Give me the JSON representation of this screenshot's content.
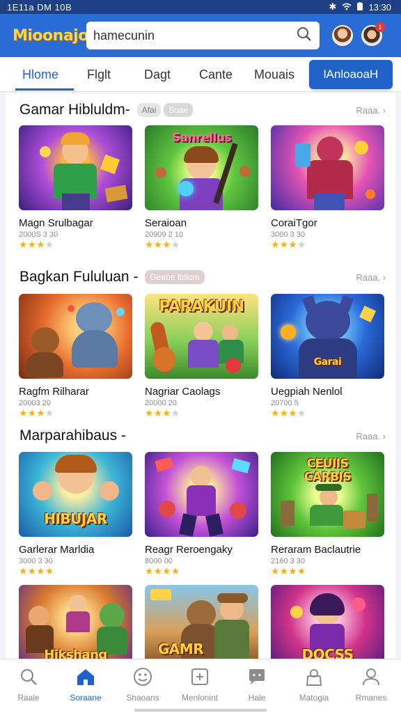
{
  "status_bar": {
    "left_text": "1E11a DM 10B",
    "time": "13:30"
  },
  "header": {
    "logo": "Mioonajo",
    "search": {
      "value": "hamecunin",
      "placeholder": ""
    },
    "notification_count": "1"
  },
  "tabs": [
    {
      "label": "Hlome",
      "active": true
    },
    {
      "label": "Flglt",
      "active": false
    },
    {
      "label": "Dagt",
      "active": false
    },
    {
      "label": "Cante",
      "active": false
    },
    {
      "label": "Mouais",
      "active": false
    }
  ],
  "tab_button": "lAnloaoaH",
  "sections": [
    {
      "title": "Gamar Hibluldm-",
      "chips": [
        "Afai",
        "Soae"
      ],
      "see_all": "Raaa.",
      "games": [
        {
          "name": "Magn Srulbagar",
          "meta": "2000S 3 30",
          "rating": 3
        },
        {
          "name": "Seraioan",
          "meta": "20909 2 10",
          "rating": 3
        },
        {
          "name": "CoraiTgor",
          "meta": "3000 3 30",
          "rating": 3
        }
      ]
    },
    {
      "title": "Bagkan Fululuan -",
      "chips": [
        "Geabe lbtiom"
      ],
      "see_all": "Raaa.",
      "games": [
        {
          "name": "Ragfm Rilharar",
          "meta": "20003 20",
          "rating": 3
        },
        {
          "name": "Nagriar Caolags",
          "meta": "20000 20",
          "rating": 3
        },
        {
          "name": "Uegpiah Nenlol",
          "meta": "20700 5",
          "rating": 3
        }
      ]
    },
    {
      "title": "Marparahibaus -",
      "chips": [],
      "see_all": "Raaa.",
      "games": [
        {
          "name": "Garlerar Marldia",
          "meta": "3000 3 30",
          "rating": 4
        },
        {
          "name": "Reagr Reroengaky",
          "meta": "8000 00",
          "rating": 4
        },
        {
          "name": "Reraram Baclautrie",
          "meta": "2160 3 30",
          "rating": 4
        }
      ]
    },
    {
      "title": "",
      "chips": [],
      "see_all": "",
      "games": [
        {
          "name": "",
          "meta": "",
          "rating": 0
        },
        {
          "name": "",
          "meta": "",
          "rating": 0
        },
        {
          "name": "",
          "meta": "",
          "rating": 0
        }
      ]
    }
  ],
  "thumb_titles": {
    "s1g2": "Sanrellus",
    "s2g2": "PARAKUIN",
    "s2g3": "Garai",
    "s3g1": "HIBUJAR",
    "s3g3": "CEUIIS CARBIS",
    "s4g1": "Hikshang",
    "s4g2": "GAMR",
    "s4g3": "DOCSS"
  },
  "bottom_nav": [
    {
      "label": "Raale",
      "icon": "search-icon",
      "active": false
    },
    {
      "label": "Soraane",
      "icon": "home-icon",
      "active": true
    },
    {
      "label": "Shaoans",
      "icon": "face-icon",
      "active": false
    },
    {
      "label": "Menlonint",
      "icon": "controller-icon",
      "active": false
    },
    {
      "label": "Hale",
      "icon": "chat-icon",
      "active": false
    },
    {
      "label": "Matogia",
      "icon": "bag-icon",
      "active": false
    },
    {
      "label": "Rmanes",
      "icon": "profile-icon",
      "active": false
    }
  ],
  "colors": {
    "brand_blue": "#2a6cd6",
    "accent_blue": "#1f63c9",
    "star": "#f2b21b"
  }
}
